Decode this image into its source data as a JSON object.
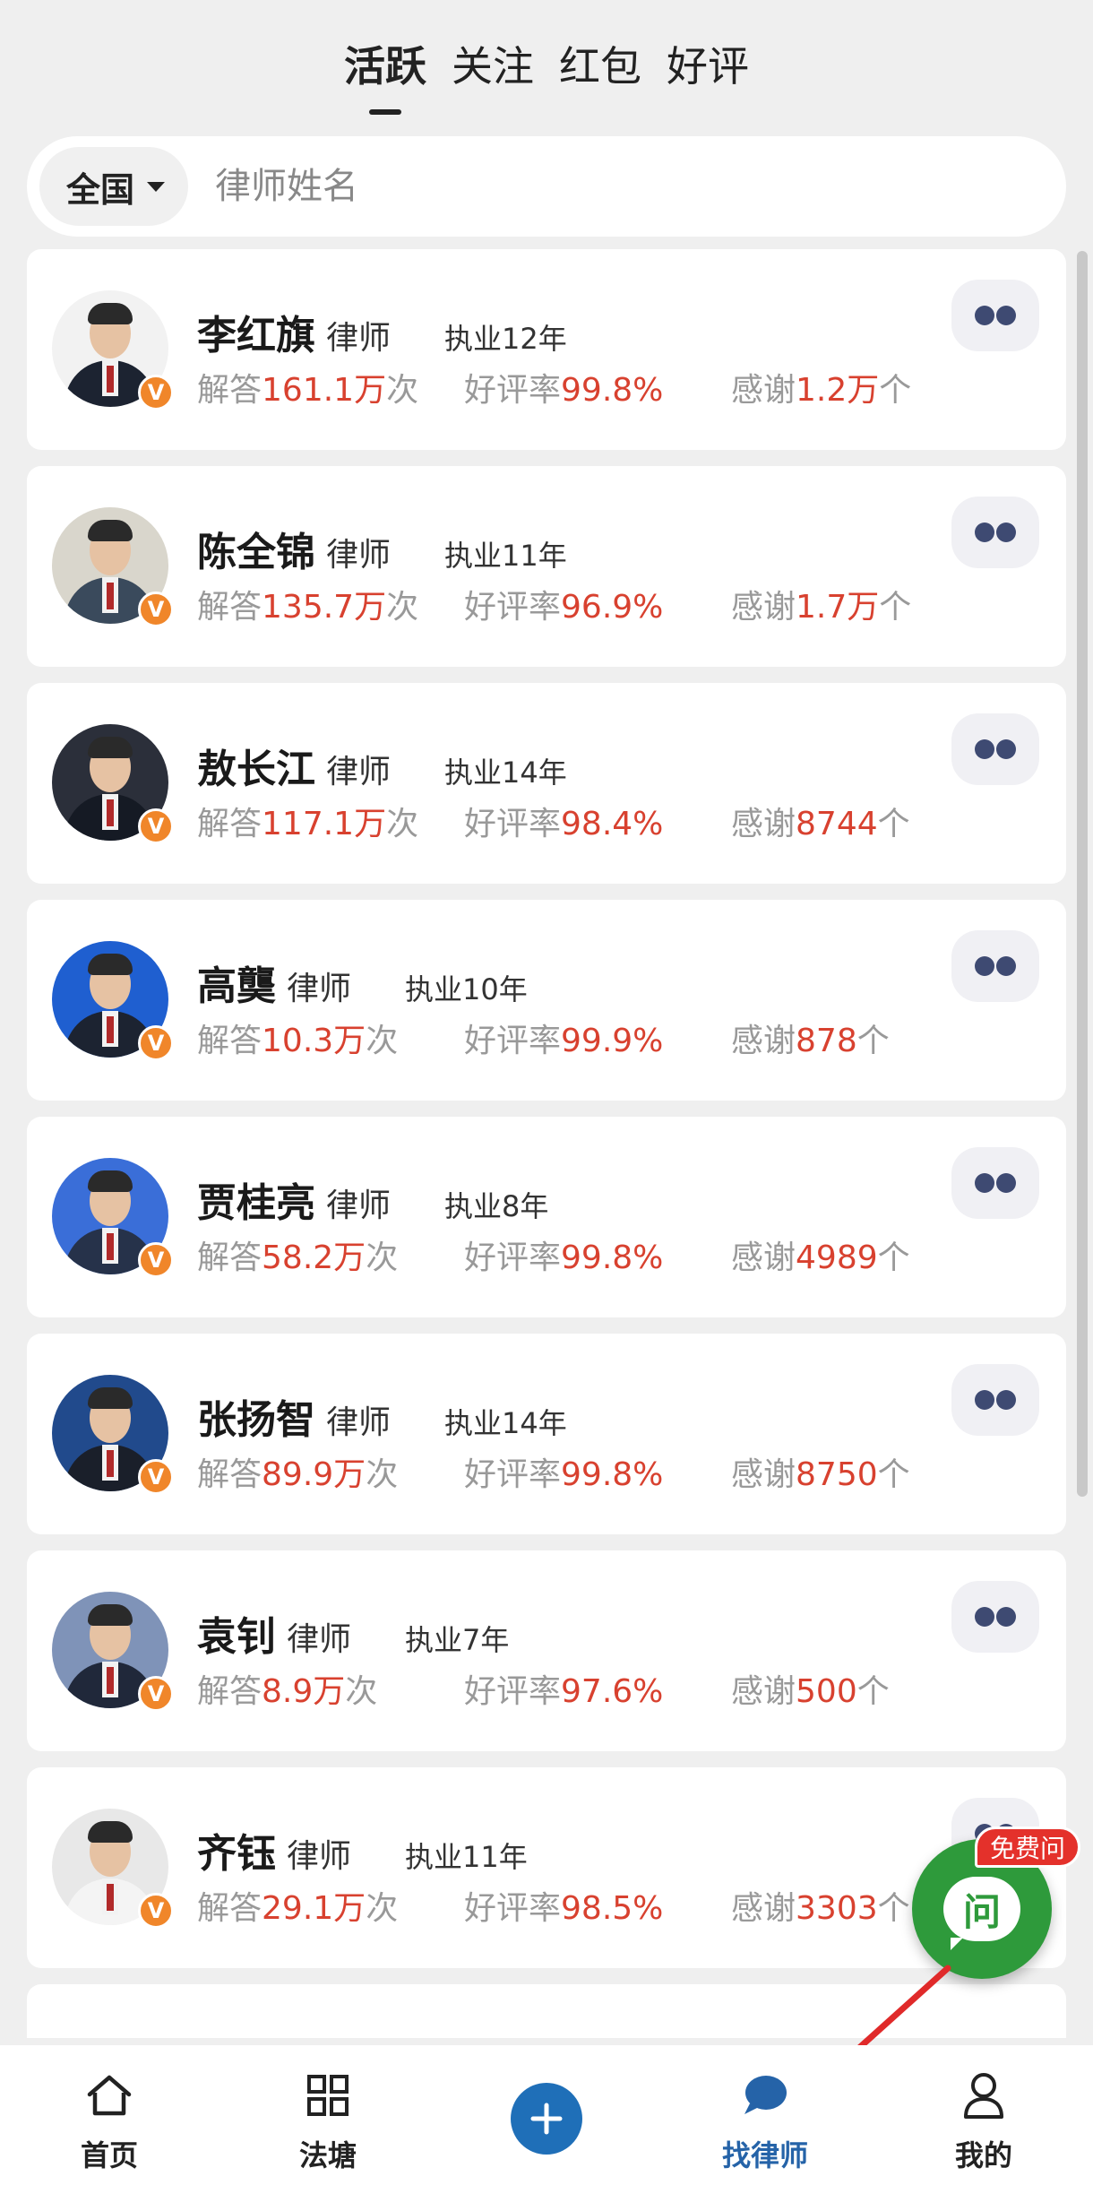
{
  "top_tabs": [
    {
      "label": "活跃",
      "active": true
    },
    {
      "label": "关注",
      "active": false
    },
    {
      "label": "红包",
      "active": false
    },
    {
      "label": "好评",
      "active": false
    }
  ],
  "search": {
    "region": "全国",
    "placeholder": "律师姓名"
  },
  "stat_labels": {
    "answers_prefix": "解答",
    "answers_suffix": "次",
    "rating_prefix": "好评率",
    "thanks_prefix": "感谢",
    "thanks_suffix": "个",
    "verified_badge": "V"
  },
  "lawyers": [
    {
      "name": "李红旗",
      "title": "律师",
      "experience": "执业12年",
      "answers": "161.1万",
      "rating": "99.8%",
      "thanks": "1.2万"
    },
    {
      "name": "陈全锦",
      "title": "律师",
      "experience": "执业11年",
      "answers": "135.7万",
      "rating": "96.9%",
      "thanks": "1.7万"
    },
    {
      "name": "敖长江",
      "title": "律师",
      "experience": "执业14年",
      "answers": "117.1万",
      "rating": "98.4%",
      "thanks": "8744"
    },
    {
      "name": "高龑",
      "title": "律师",
      "experience": "执业10年",
      "answers": "10.3万",
      "rating": "99.9%",
      "thanks": "878"
    },
    {
      "name": "贾桂亮",
      "title": "律师",
      "experience": "执业8年",
      "answers": "58.2万",
      "rating": "99.8%",
      "thanks": "4989"
    },
    {
      "name": "张扬智",
      "title": "律师",
      "experience": "执业14年",
      "answers": "89.9万",
      "rating": "99.8%",
      "thanks": "8750"
    },
    {
      "name": "袁钊",
      "title": "律师",
      "experience": "执业7年",
      "answers": "8.9万",
      "rating": "97.6%",
      "thanks": "500"
    },
    {
      "name": "齐钰",
      "title": "律师",
      "experience": "执业11年",
      "answers": "29.1万",
      "rating": "98.5%",
      "thanks": "3303"
    }
  ],
  "fab": {
    "glyph": "问",
    "tag": "免费问"
  },
  "bottom_nav": [
    {
      "label": "首页",
      "icon": "home-icon",
      "active": false
    },
    {
      "label": "法塘",
      "icon": "grid-icon",
      "active": false
    },
    {
      "label": "",
      "icon": "plus-icon",
      "active": false
    },
    {
      "label": "找律师",
      "icon": "chat-bubble-icon",
      "active": true
    },
    {
      "label": "我的",
      "icon": "user-icon",
      "active": false
    }
  ],
  "colors": {
    "accent_red": "#d8412f",
    "nav_active": "#2563a8",
    "plus_button": "#1f6fb8",
    "fab_green": "#2e9a3b",
    "badge_orange": "#f0862a",
    "annotation_arrow": "#e02a2a"
  }
}
